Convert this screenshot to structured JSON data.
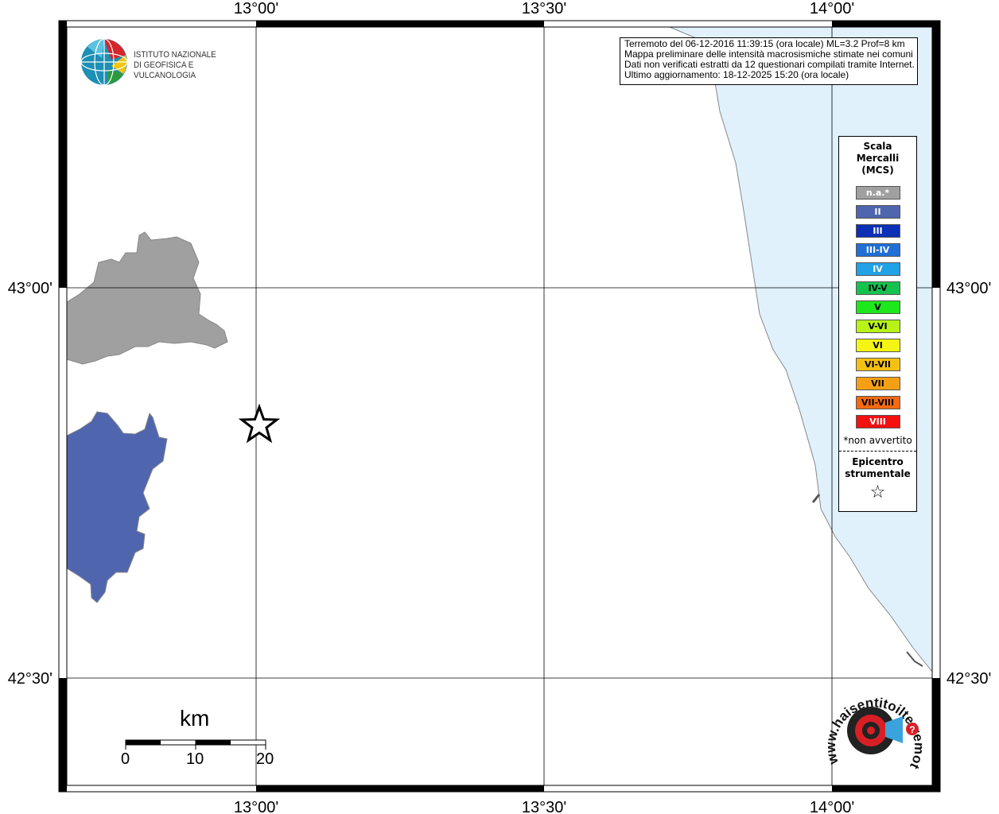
{
  "map": {
    "lon_ticks": [
      "13°00'",
      "13°30'",
      "14°00'"
    ],
    "lat_ticks": [
      "43°00'",
      "42°30'"
    ]
  },
  "logo": {
    "line1": "ISTITUTO NAZIONALE",
    "line2": "DI GEOFISICA E VULCANOLOGIA"
  },
  "info": {
    "line1": "Terremoto del 06-12-2016 11:39:15 (ora locale) ML=3.2 Prof=8 km",
    "line2": "Mappa preliminare delle intensità macrosismiche stimate nei comuni",
    "line3": "Dati non verificati estratti da 12 questionari compilati tramite Internet.",
    "line4": "Ultimo aggiornamento: 18-12-2025 15:20 (ora locale)"
  },
  "legend": {
    "title1": "Scala",
    "title2": "Mercalli",
    "title3": "(MCS)",
    "items": [
      {
        "label": "n.a.*",
        "color": "#a0a0a0",
        "text": "#ffffff"
      },
      {
        "label": "II",
        "color": "#4f65ad",
        "text": "#ffffff"
      },
      {
        "label": "III",
        "color": "#0b2fb5",
        "text": "#ffffff"
      },
      {
        "label": "III-IV",
        "color": "#1f6fd6",
        "text": "#ffffff"
      },
      {
        "label": "IV",
        "color": "#21a1e6",
        "text": "#ffffff"
      },
      {
        "label": "IV-V",
        "color": "#16c24e",
        "text": "#000000"
      },
      {
        "label": "V",
        "color": "#1ce81c",
        "text": "#000000"
      },
      {
        "label": "V-VI",
        "color": "#b8f217",
        "text": "#000000"
      },
      {
        "label": "VI",
        "color": "#f5f513",
        "text": "#000000"
      },
      {
        "label": "VI-VII",
        "color": "#f5c014",
        "text": "#000000"
      },
      {
        "label": "VII",
        "color": "#f5a014",
        "text": "#000000"
      },
      {
        "label": "VII-VIII",
        "color": "#f56a10",
        "text": "#000000"
      },
      {
        "label": "VIII",
        "color": "#f51010",
        "text": "#ffffff"
      }
    ],
    "note": "*non avvertito",
    "epi1": "Epicentro",
    "epi2": "strumentale",
    "star": "☆"
  },
  "scale_bar": {
    "unit": "km",
    "labels": [
      "0",
      "10",
      "20"
    ]
  },
  "hsi_logo": {
    "text": "www.haisentitoilterremoto.it"
  },
  "colors": {
    "sea": "#e0f1fc",
    "intensity_ii": "#4f65ad",
    "not_felt": "#a0a0a0",
    "coast": "#888888"
  }
}
